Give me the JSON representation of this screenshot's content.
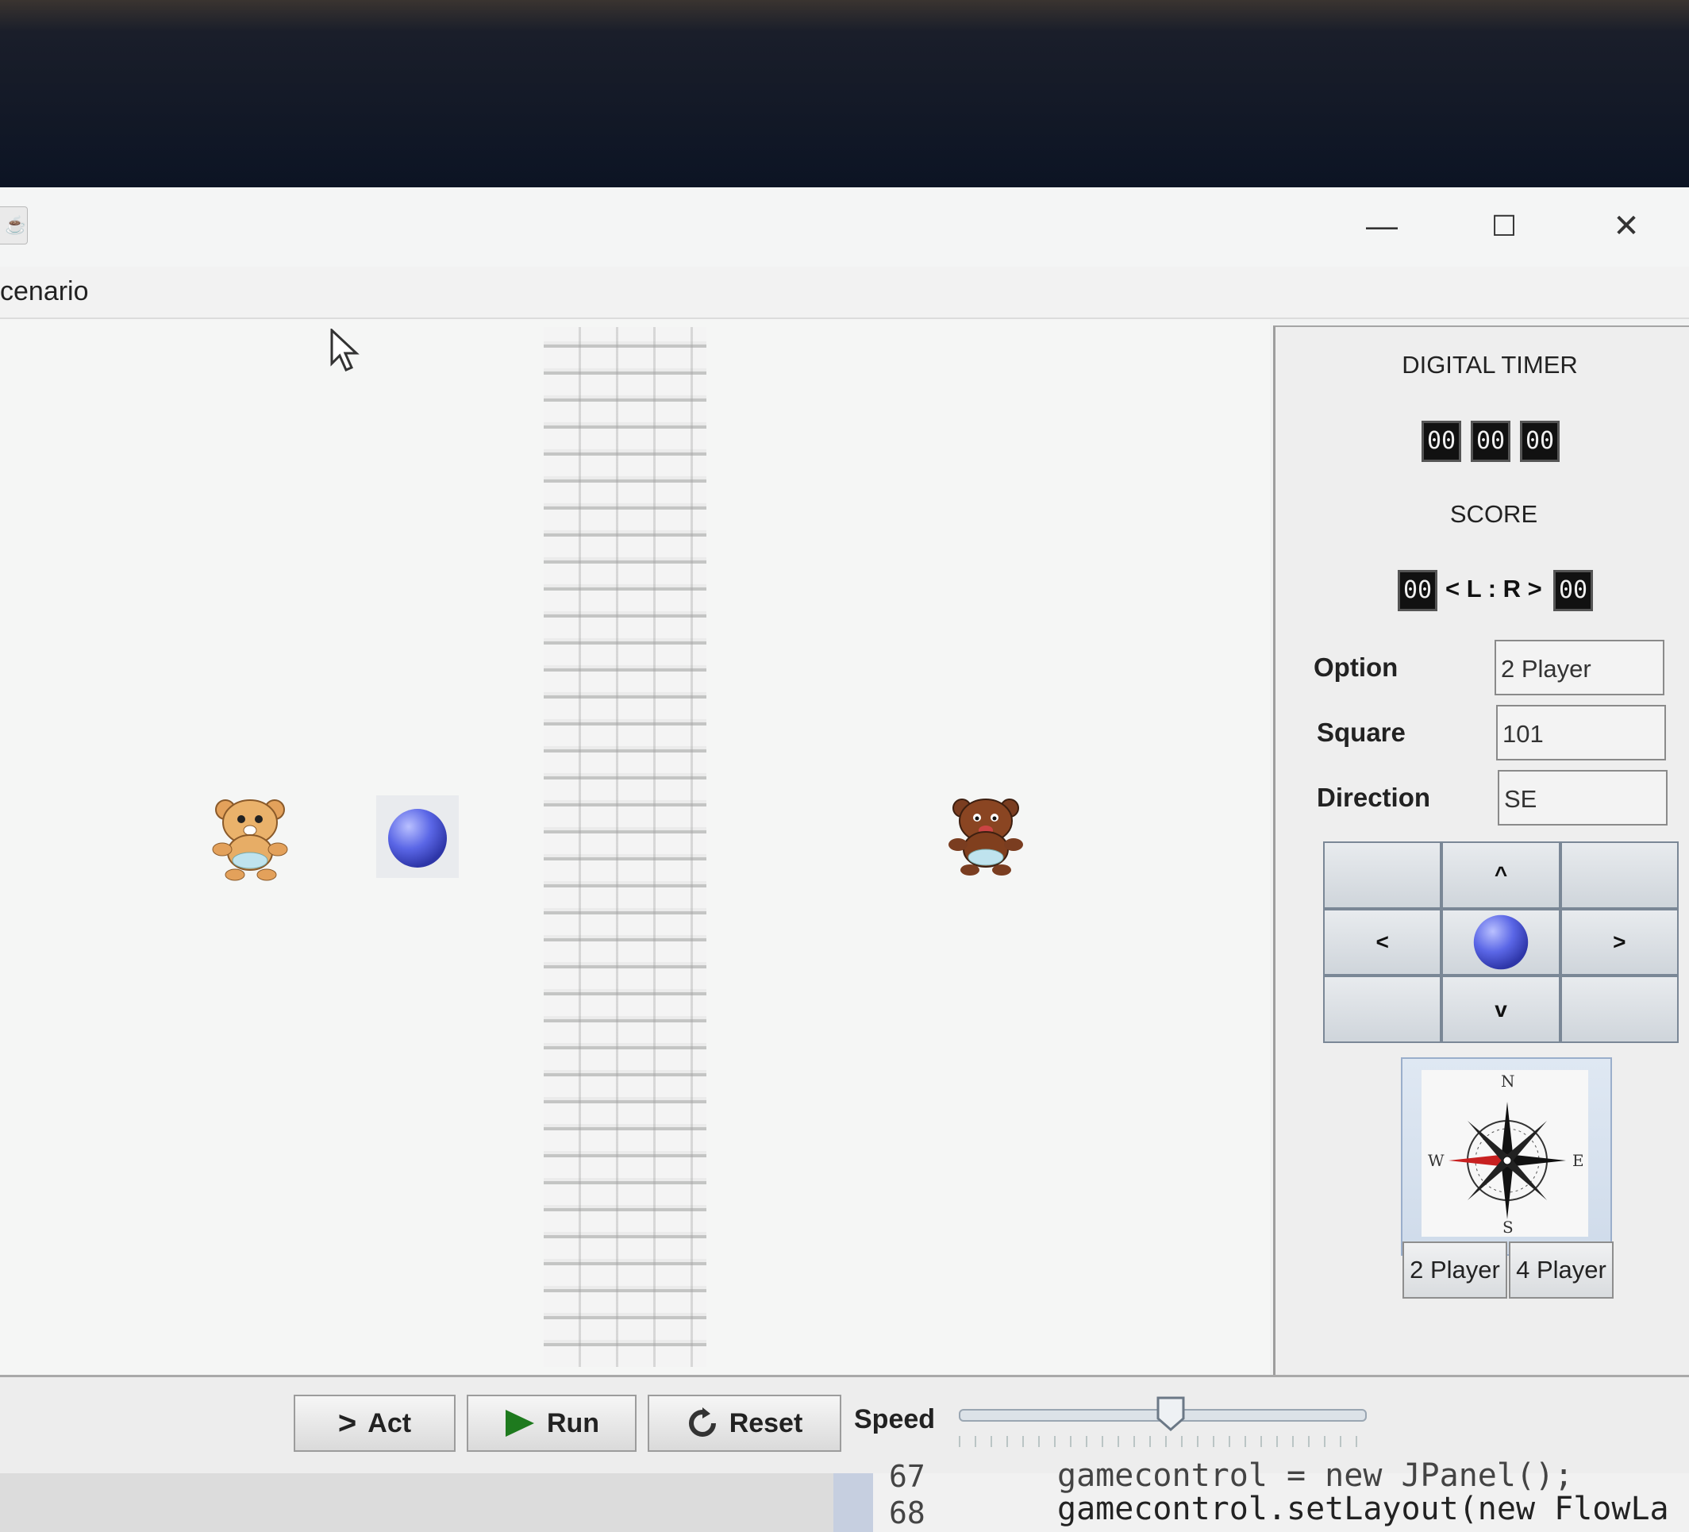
{
  "window": {
    "menu_label": "cenario",
    "controls": {
      "minimize": "—",
      "maximize": "☐",
      "close": "✕"
    }
  },
  "sidebar": {
    "timer_title": "DIGITAL TIMER",
    "timer_digits": [
      "00",
      "00",
      "00"
    ],
    "score_title": "SCORE",
    "score_left": "00",
    "score_sep": "< L : R >",
    "score_right": "00",
    "option_label": "Option",
    "option_value": "2 Player",
    "square_label": "Square",
    "square_value": "101",
    "direction_label": "Direction",
    "direction_value": "SE",
    "dpad": {
      "up": "^",
      "left": "<",
      "right": ">",
      "down": "v"
    },
    "compass": {
      "n": "N",
      "e": "E",
      "s": "S",
      "w": "W"
    },
    "buttons": {
      "two_player": "2 Player",
      "four_player": "4 Player"
    }
  },
  "controls": {
    "act": "Act",
    "run": "Run",
    "reset": "Reset",
    "speed": "Speed",
    "speed_fraction": 0.5
  },
  "code": {
    "lines": [
      {
        "num": "67",
        "text": "gamecontrol = new JPanel();"
      },
      {
        "num": "68",
        "text": "gamecontrol.setLayout(new FlowLa"
      }
    ]
  },
  "colors": {
    "ball": "#5865e0",
    "bear_light": "#e8a760",
    "bear_dark": "#7a3d20"
  }
}
